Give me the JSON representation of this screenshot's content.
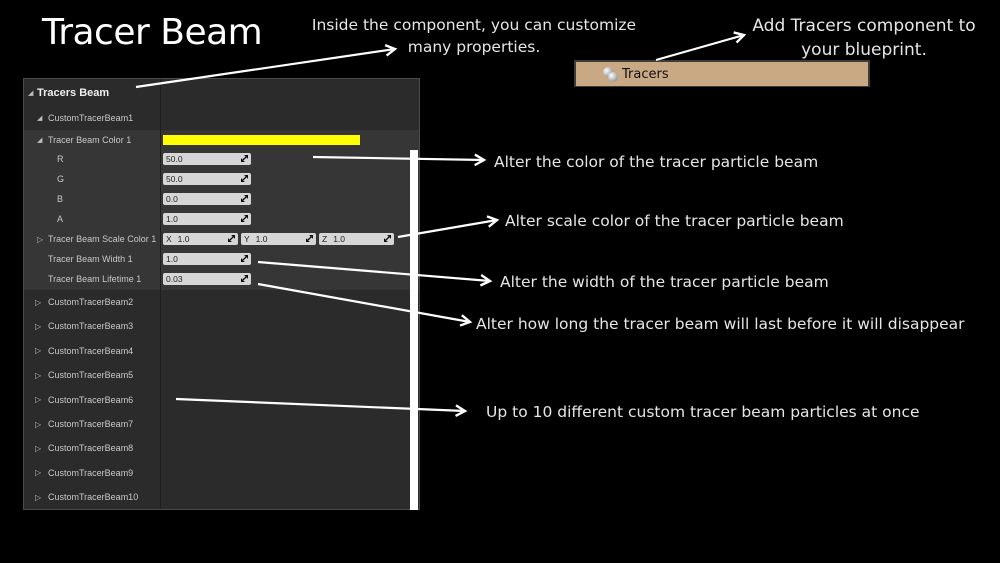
{
  "title": "Tracer Beam",
  "notes": {
    "inside_component": "Inside the component, you can customize many properties.",
    "add_component": "Add Tracers component to your blueprint.",
    "color": "Alter the color of the tracer particle beam",
    "scale_color": "Alter scale color of the tracer particle beam",
    "width": "Alter the width of the tracer particle beam",
    "lifetime": "Alter how long the tracer beam will last before it will disappear",
    "up_to_ten": "Up to 10 different custom tracer beam particles at once"
  },
  "component": {
    "label": "Tracers",
    "icon": "component-spheres-icon",
    "color": "#c9a884"
  },
  "panel": {
    "section": "Tracers Beam",
    "expanded_item": "CustomTracerBeam1",
    "color_property": {
      "label": "Tracer Beam Color 1",
      "swatch": "#ffff00",
      "channels": [
        {
          "label": "R",
          "value": "50.0"
        },
        {
          "label": "G",
          "value": "50.0"
        },
        {
          "label": "B",
          "value": "0.0"
        },
        {
          "label": "A",
          "value": "1.0"
        }
      ]
    },
    "scale_color": {
      "label": "Tracer Beam Scale Color 1",
      "x_label": "X",
      "x": "1.0",
      "y_label": "Y",
      "y": "1.0",
      "z_label": "Z",
      "z": "1.0"
    },
    "width": {
      "label": "Tracer Beam Width 1",
      "value": "1.0"
    },
    "lifetime": {
      "label": "Tracer Beam Lifetime 1",
      "value": "0.03"
    },
    "collapsed_items": [
      "CustomTracerBeam2",
      "CustomTracerBeam3",
      "CustomTracerBeam4",
      "CustomTracerBeam5",
      "CustomTracerBeam6",
      "CustomTracerBeam7",
      "CustomTracerBeam8",
      "CustomTracerBeam9",
      "CustomTracerBeam10"
    ]
  }
}
